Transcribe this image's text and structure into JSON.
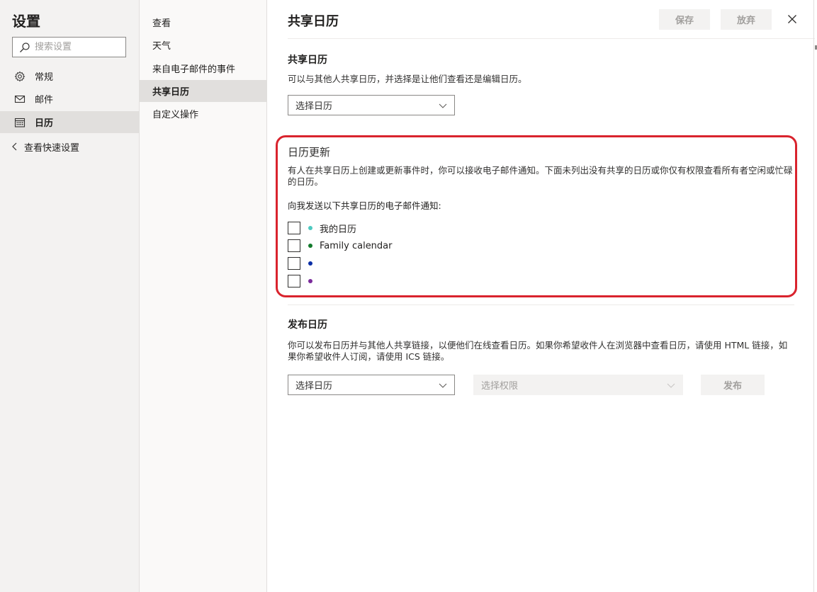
{
  "nav": {
    "title": "设置",
    "search_placeholder": "搜索设置",
    "items": [
      {
        "label": "常规",
        "icon": "gear-icon"
      },
      {
        "label": "邮件",
        "icon": "mail-icon"
      },
      {
        "label": "日历",
        "icon": "calendar-icon",
        "active": true
      }
    ],
    "back_label": "查看快速设置"
  },
  "subnav": {
    "items": [
      {
        "label": "查看"
      },
      {
        "label": "天气"
      },
      {
        "label": "来自电子邮件的事件"
      },
      {
        "label": "共享日历",
        "active": true
      },
      {
        "label": "自定义操作"
      }
    ]
  },
  "header": {
    "title": "共享日历",
    "save_label": "保存",
    "discard_label": "放弃"
  },
  "share": {
    "title": "共享日历",
    "desc": "可以与其他人共享日历，并选择是让他们查看还是编辑日历。",
    "dropdown_value": "选择日历"
  },
  "updates": {
    "title": "日历更新",
    "desc": "有人在共享日历上创建或更新事件时，你可以接收电子邮件通知。下面未列出没有共享的日历或你仅有权限查看所有者空闲或忙碌的日历。",
    "notify_label": "向我发送以下共享日历的电子邮件通知:",
    "calendars": [
      {
        "name": "我的日历",
        "color": "#4dc9c0",
        "checked": false
      },
      {
        "name": "Family calendar",
        "color": "#127a2c",
        "checked": false
      },
      {
        "name": "",
        "color": "#0b2fa6",
        "checked": false
      },
      {
        "name": "",
        "color": "#7a2b9b",
        "checked": false
      }
    ]
  },
  "publish": {
    "title": "发布日历",
    "desc": "你可以发布日历并与其他人共享链接，以便他们在线查看日历。如果你希望收件人在浏览器中查看日历，请使用 HTML 链接，如果你希望收件人订阅，请使用 ICS 链接。",
    "calendar_value": "选择日历",
    "permission_value": "选择权限",
    "publish_label": "发布"
  },
  "colors": {
    "highlight_box": "#d9232d",
    "nav_bg": "#f3f2f1",
    "active_bg": "#e1dfdd"
  }
}
